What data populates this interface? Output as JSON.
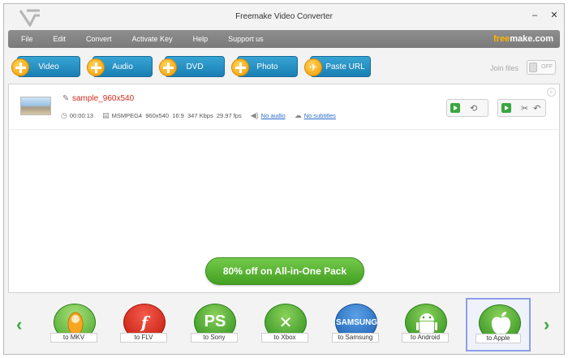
{
  "window": {
    "title": "Freemake Video Converter",
    "controls": {
      "minimize": "–",
      "close": "✕"
    }
  },
  "menu": {
    "items": [
      "File",
      "Edit",
      "Convert",
      "Activate Key",
      "Help",
      "Support us"
    ],
    "brand_part1": "free",
    "brand_part2": "make.com"
  },
  "toolbar": {
    "video_label": "Video",
    "audio_label": "Audio",
    "dvd_label": "DVD",
    "photo_label": "Photo",
    "paste_url_label": "Paste URL",
    "join_files_label": "Join files",
    "join_toggle_state": "OFF"
  },
  "file": {
    "name": "sample_960x540",
    "duration": "00:00:13",
    "codec": "MSMPEG4",
    "resolution": "960x540",
    "aspect": "16:9",
    "bitrate": "347 Kbps",
    "fps": "29.97 fps",
    "audio": "No audio",
    "subtitles": "No subtitles"
  },
  "promo": {
    "label": "80% off on All-in-One Pack"
  },
  "targets": [
    {
      "label": "to MKV",
      "icon": "matryoshka-icon"
    },
    {
      "label": "to FLV",
      "icon": "flash-icon",
      "glyph": "f"
    },
    {
      "label": "to Sony",
      "icon": "playstation-icon",
      "glyph": "PS"
    },
    {
      "label": "to Xbox",
      "icon": "xbox-icon",
      "glyph": "✕"
    },
    {
      "label": "to Samsung",
      "icon": "samsung-icon",
      "glyph": "SAMSUNG"
    },
    {
      "label": "to Android",
      "icon": "android-icon"
    },
    {
      "label": "to Apple",
      "icon": "apple-icon"
    }
  ],
  "nav": {
    "prev": "‹",
    "next": "›"
  },
  "colors": {
    "accent_blue": "#1a7fb4",
    "accent_orange": "#f39a00",
    "accent_green": "#3aa640",
    "filename_red": "#d42a1a"
  }
}
